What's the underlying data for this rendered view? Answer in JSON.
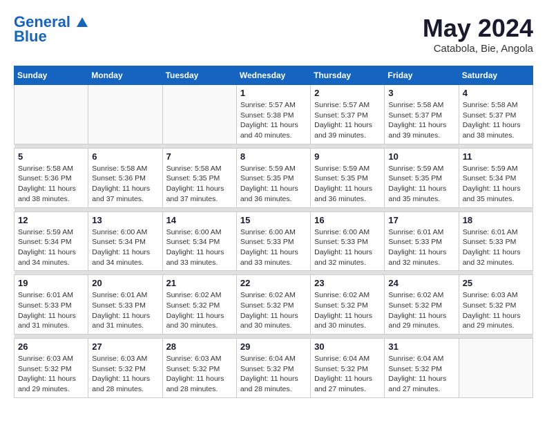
{
  "header": {
    "logo_line1": "General",
    "logo_line2": "Blue",
    "month_year": "May 2024",
    "location": "Catabola, Bie, Angola"
  },
  "weekdays": [
    "Sunday",
    "Monday",
    "Tuesday",
    "Wednesday",
    "Thursday",
    "Friday",
    "Saturday"
  ],
  "weeks": [
    [
      {
        "day": "",
        "info": ""
      },
      {
        "day": "",
        "info": ""
      },
      {
        "day": "",
        "info": ""
      },
      {
        "day": "1",
        "info": "Sunrise: 5:57 AM\nSunset: 5:38 PM\nDaylight: 11 hours\nand 40 minutes."
      },
      {
        "day": "2",
        "info": "Sunrise: 5:57 AM\nSunset: 5:37 PM\nDaylight: 11 hours\nand 39 minutes."
      },
      {
        "day": "3",
        "info": "Sunrise: 5:58 AM\nSunset: 5:37 PM\nDaylight: 11 hours\nand 39 minutes."
      },
      {
        "day": "4",
        "info": "Sunrise: 5:58 AM\nSunset: 5:37 PM\nDaylight: 11 hours\nand 38 minutes."
      }
    ],
    [
      {
        "day": "5",
        "info": "Sunrise: 5:58 AM\nSunset: 5:36 PM\nDaylight: 11 hours\nand 38 minutes."
      },
      {
        "day": "6",
        "info": "Sunrise: 5:58 AM\nSunset: 5:36 PM\nDaylight: 11 hours\nand 37 minutes."
      },
      {
        "day": "7",
        "info": "Sunrise: 5:58 AM\nSunset: 5:35 PM\nDaylight: 11 hours\nand 37 minutes."
      },
      {
        "day": "8",
        "info": "Sunrise: 5:59 AM\nSunset: 5:35 PM\nDaylight: 11 hours\nand 36 minutes."
      },
      {
        "day": "9",
        "info": "Sunrise: 5:59 AM\nSunset: 5:35 PM\nDaylight: 11 hours\nand 36 minutes."
      },
      {
        "day": "10",
        "info": "Sunrise: 5:59 AM\nSunset: 5:35 PM\nDaylight: 11 hours\nand 35 minutes."
      },
      {
        "day": "11",
        "info": "Sunrise: 5:59 AM\nSunset: 5:34 PM\nDaylight: 11 hours\nand 35 minutes."
      }
    ],
    [
      {
        "day": "12",
        "info": "Sunrise: 5:59 AM\nSunset: 5:34 PM\nDaylight: 11 hours\nand 34 minutes."
      },
      {
        "day": "13",
        "info": "Sunrise: 6:00 AM\nSunset: 5:34 PM\nDaylight: 11 hours\nand 34 minutes."
      },
      {
        "day": "14",
        "info": "Sunrise: 6:00 AM\nSunset: 5:34 PM\nDaylight: 11 hours\nand 33 minutes."
      },
      {
        "day": "15",
        "info": "Sunrise: 6:00 AM\nSunset: 5:33 PM\nDaylight: 11 hours\nand 33 minutes."
      },
      {
        "day": "16",
        "info": "Sunrise: 6:00 AM\nSunset: 5:33 PM\nDaylight: 11 hours\nand 32 minutes."
      },
      {
        "day": "17",
        "info": "Sunrise: 6:01 AM\nSunset: 5:33 PM\nDaylight: 11 hours\nand 32 minutes."
      },
      {
        "day": "18",
        "info": "Sunrise: 6:01 AM\nSunset: 5:33 PM\nDaylight: 11 hours\nand 32 minutes."
      }
    ],
    [
      {
        "day": "19",
        "info": "Sunrise: 6:01 AM\nSunset: 5:33 PM\nDaylight: 11 hours\nand 31 minutes."
      },
      {
        "day": "20",
        "info": "Sunrise: 6:01 AM\nSunset: 5:33 PM\nDaylight: 11 hours\nand 31 minutes."
      },
      {
        "day": "21",
        "info": "Sunrise: 6:02 AM\nSunset: 5:32 PM\nDaylight: 11 hours\nand 30 minutes."
      },
      {
        "day": "22",
        "info": "Sunrise: 6:02 AM\nSunset: 5:32 PM\nDaylight: 11 hours\nand 30 minutes."
      },
      {
        "day": "23",
        "info": "Sunrise: 6:02 AM\nSunset: 5:32 PM\nDaylight: 11 hours\nand 30 minutes."
      },
      {
        "day": "24",
        "info": "Sunrise: 6:02 AM\nSunset: 5:32 PM\nDaylight: 11 hours\nand 29 minutes."
      },
      {
        "day": "25",
        "info": "Sunrise: 6:03 AM\nSunset: 5:32 PM\nDaylight: 11 hours\nand 29 minutes."
      }
    ],
    [
      {
        "day": "26",
        "info": "Sunrise: 6:03 AM\nSunset: 5:32 PM\nDaylight: 11 hours\nand 29 minutes."
      },
      {
        "day": "27",
        "info": "Sunrise: 6:03 AM\nSunset: 5:32 PM\nDaylight: 11 hours\nand 28 minutes."
      },
      {
        "day": "28",
        "info": "Sunrise: 6:03 AM\nSunset: 5:32 PM\nDaylight: 11 hours\nand 28 minutes."
      },
      {
        "day": "29",
        "info": "Sunrise: 6:04 AM\nSunset: 5:32 PM\nDaylight: 11 hours\nand 28 minutes."
      },
      {
        "day": "30",
        "info": "Sunrise: 6:04 AM\nSunset: 5:32 PM\nDaylight: 11 hours\nand 27 minutes."
      },
      {
        "day": "31",
        "info": "Sunrise: 6:04 AM\nSunset: 5:32 PM\nDaylight: 11 hours\nand 27 minutes."
      },
      {
        "day": "",
        "info": ""
      }
    ]
  ]
}
